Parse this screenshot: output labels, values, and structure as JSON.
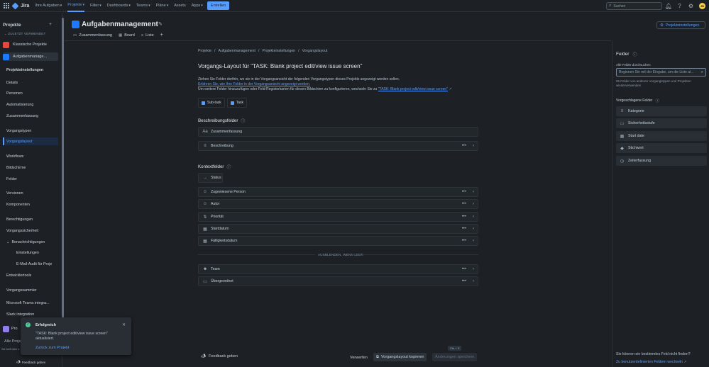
{
  "topnav": {
    "logo": "Jira",
    "items": [
      {
        "label": "Ihre Aufgaben",
        "active": false
      },
      {
        "label": "Projekte",
        "active": true
      },
      {
        "label": "Filter",
        "active": false
      },
      {
        "label": "Dashboards",
        "active": false
      },
      {
        "label": "Teams",
        "active": false
      },
      {
        "label": "Pläne",
        "active": false
      },
      {
        "label": "Assets",
        "active": false
      },
      {
        "label": "Apps",
        "active": false
      }
    ],
    "create": "Erstellen",
    "search_placeholder": "Suchen",
    "avatar": "JB"
  },
  "sidebar": {
    "title": "Projekte",
    "recent_label": "ZULETZT VERWENDET",
    "projects": [
      {
        "label": "Klassische Projekte",
        "color": "#e2483d"
      },
      {
        "label": "Aufgabenmanage...",
        "color": "#1d7afc"
      }
    ],
    "items": [
      {
        "label": "Projekteinstellungen",
        "bold": true
      },
      {
        "label": "Details"
      },
      {
        "label": "Personen"
      },
      {
        "label": "Automatisierung"
      },
      {
        "label": "Zusammenfassung"
      },
      {
        "label": "Vorgangstypen"
      },
      {
        "label": "Vorgangslayout",
        "active": true
      },
      {
        "label": "Workflows"
      },
      {
        "label": "Bildschirme"
      },
      {
        "label": "Felder"
      },
      {
        "label": "Versionen"
      },
      {
        "label": "Komponenten"
      },
      {
        "label": "Berechtigungen"
      },
      {
        "label": "Vorgangssicherheit"
      },
      {
        "label": "Benachrichtigungen",
        "expanded": true
      },
      {
        "label": "Einstellungen",
        "sub": true
      },
      {
        "label": "E-Mail-Audit für Proje",
        "sub": true
      },
      {
        "label": "Entwicklertools"
      },
      {
        "label": "Vorgangssammler"
      },
      {
        "label": "Microsoft Teams integra..."
      },
      {
        "label": "Slack integration"
      }
    ],
    "bottom_project": "Pro",
    "all_projects": "Alle Proje",
    "small_note": "Sie befinden s",
    "feedback": "Feedback geben"
  },
  "header": {
    "title": "Aufgabenmanagement",
    "tabs": [
      "Zusammenfassung",
      "Board",
      "Liste"
    ],
    "settings_button": "Projekteinstellungen"
  },
  "main": {
    "breadcrumb": [
      "Projekte",
      "Aufgabenmanagement",
      "Projekteinstellungen",
      "Vorgangslayout"
    ],
    "heading": "Vorgangs-Layout für \"TASK: Blank project edit/view issue screen\"",
    "desc_line1": "Ziehen Sie Felder dorthin, wo sie in der Vorgangsansicht der folgenden Vorgangstypen dieses Projekts angezeigt werden sollen.",
    "desc_link": "Erfahren Sie, wie Ihre Felder in der Vorgangsansicht angezeigt werden.",
    "desc_line3": "Um weitere Felder hinzuzufügen oder Feld-Registerkarten für diesen Bildschirm zu konfigurieren, wechseln Sie zu",
    "desc_link2": "\"TASK: Blank project edit/view issue screen\"",
    "issue_types": [
      {
        "label": "Sub-task",
        "color": "#579dff"
      },
      {
        "label": "Task",
        "color": "#579dff"
      }
    ],
    "description_section": "Beschreibungsfelder",
    "description_fields": [
      {
        "label": "Zusammenfassung",
        "icon": "Aa",
        "actions": false
      },
      {
        "label": "Beschreibung",
        "icon": "≡",
        "actions": true
      }
    ],
    "context_section": "Kontextfelder",
    "status_field": {
      "label": "Status",
      "icon": "→"
    },
    "context_fields": [
      {
        "label": "Zugewiesene Person",
        "icon": "☺"
      },
      {
        "label": "Autor",
        "icon": "☺"
      },
      {
        "label": "Priorität",
        "icon": "⇅"
      },
      {
        "label": "Startdatum",
        "icon": "▦"
      },
      {
        "label": "Fälligkeitsdatum",
        "icon": "▦"
      }
    ],
    "hidden_label": "AUSBLENDEN, WENN LEER",
    "hidden_fields": [
      {
        "label": "Team",
        "icon": "☻"
      },
      {
        "label": "Übergeordnet",
        "icon": "▭"
      }
    ]
  },
  "right_panel": {
    "title": "Felder",
    "search_label": "Alle Felder durchsuchen",
    "search_placeholder": "Beginnen Sie mit der Eingabe, um die Liste al...",
    "note": "55 Felder von anderen Vorgangstypen und Projekten wiederverwenden",
    "suggested_label": "Vorgeschlagene Felder",
    "suggested": [
      {
        "label": "Kategorie",
        "icon": "≡"
      },
      {
        "label": "Sicherheitsstufe",
        "icon": "▭"
      },
      {
        "label": "Start date",
        "icon": "▦"
      },
      {
        "label": "Stichwort",
        "icon": "◆"
      },
      {
        "label": "Zeiterfassung",
        "icon": "◷"
      }
    ],
    "footer_question": "Sie können ein bestimmtes Feld nicht finden?",
    "footer_link": "Zu benutzerdefinierten Feldern wechseln"
  },
  "bottom_bar": {
    "feedback": "Feedback geben",
    "discard": "Verwerfen",
    "copy": "Vorgangslayout kopieren",
    "save": "Änderungen speichern",
    "shortcut": "Ctrl + S"
  },
  "toast": {
    "title": "Erfolgreich",
    "body": "\"TASK: Blank project edit/view issue screen\" aktualisiert.",
    "link": "Zurück zum Projekt"
  }
}
